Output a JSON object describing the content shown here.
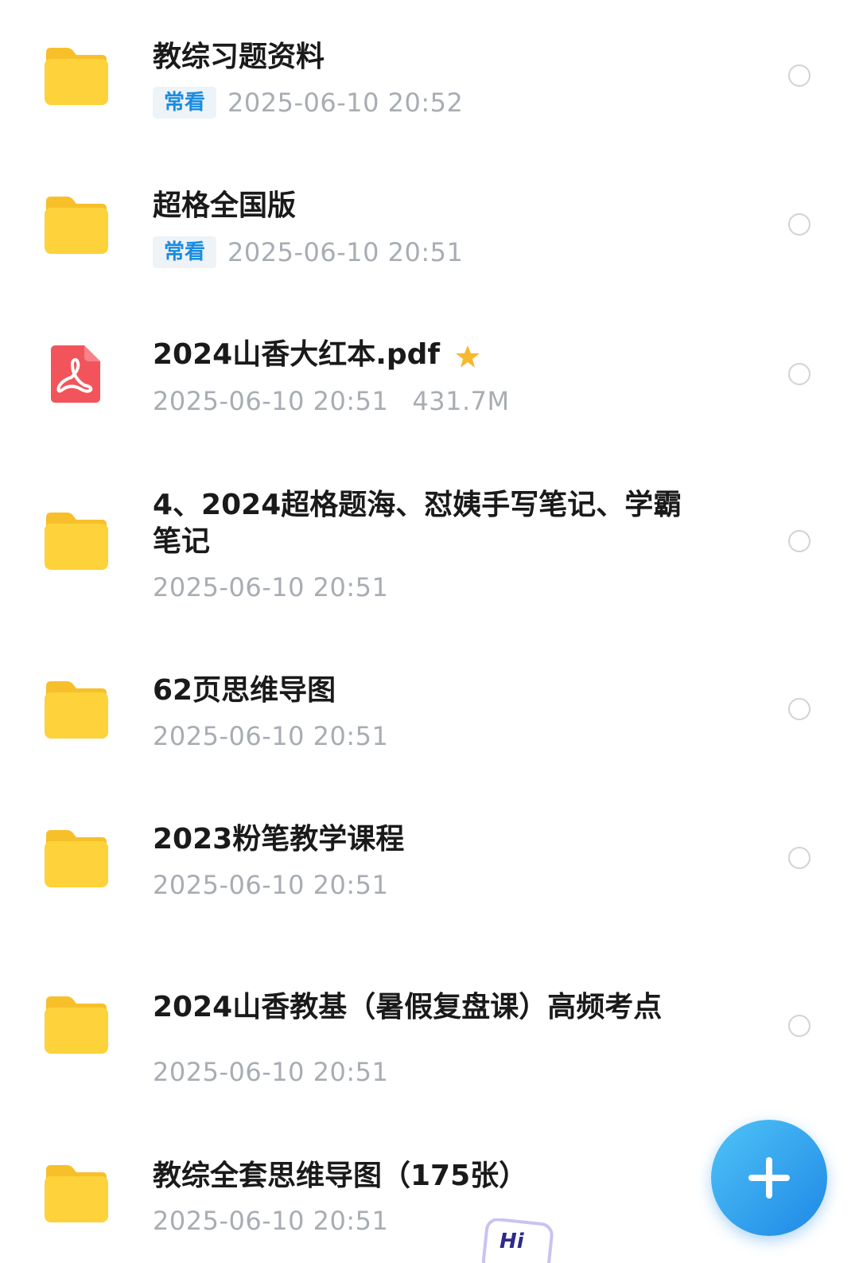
{
  "files": [
    {
      "name": "教综习题资料",
      "type": "folder",
      "badge": "常看",
      "date": "2025-06-10 20:52",
      "size": "",
      "starred": false
    },
    {
      "name": "超格全国版",
      "type": "folder",
      "badge": "常看",
      "date": "2025-06-10 20:51",
      "size": "",
      "starred": false
    },
    {
      "name": "2024山香大红本.pdf",
      "type": "pdf",
      "badge": "",
      "date": "2025-06-10 20:51",
      "size": "431.7M",
      "starred": true
    },
    {
      "name": "4、2024超格题海、怼姨手写笔记、学霸笔记",
      "type": "folder",
      "badge": "",
      "date": "2025-06-10 20:51",
      "size": "",
      "starred": false
    },
    {
      "name": "62页思维导图",
      "type": "folder",
      "badge": "",
      "date": "2025-06-10 20:51",
      "size": "",
      "starred": false
    },
    {
      "name": "2023粉笔教学课程",
      "type": "folder",
      "badge": "",
      "date": "2025-06-10 20:51",
      "size": "",
      "starred": false
    },
    {
      "name": "2024山香教基（暑假复盘课）高频考点",
      "type": "folder",
      "badge": "",
      "date": "2025-06-10 20:51",
      "size": "",
      "starred": false
    },
    {
      "name": "教综全套思维导图（175张）",
      "type": "folder",
      "badge": "",
      "date": "2025-06-10 20:51",
      "size": "",
      "starred": false
    }
  ],
  "colors": {
    "folder": "#fdd23a",
    "folder_back": "#f7c02a",
    "pdf": "#f2545b",
    "star": "#f8b830",
    "badge_text": "#1a8ce0",
    "badge_bg": "#eef3f8",
    "date_text": "#a8adb3",
    "name_text": "#1a1a1a",
    "fab": "#2b9ff0"
  },
  "fab": {
    "icon": "plus-icon"
  },
  "sticker": {
    "text": "Hi"
  }
}
